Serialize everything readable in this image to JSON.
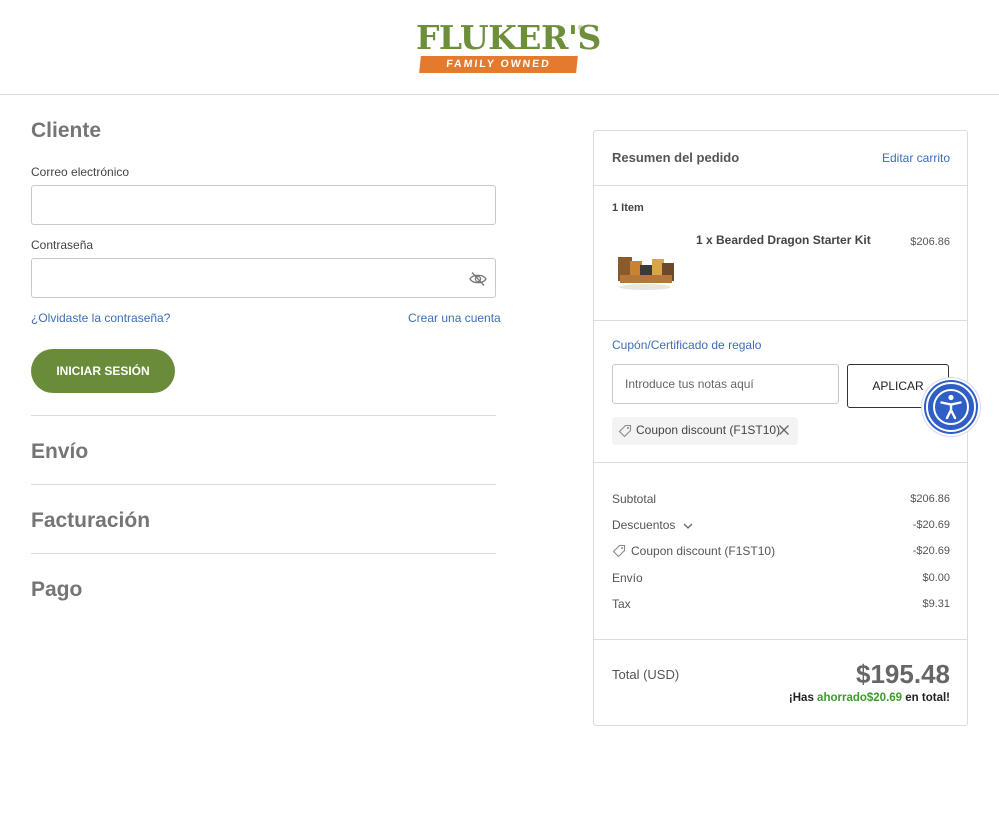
{
  "header": {
    "logo_word": "FLUKER'S",
    "logo_reg": "®",
    "logo_tagline": "FAMILY OWNED",
    "colors": {
      "green": "#6d8f3a",
      "orange": "#e47a2e"
    }
  },
  "customer": {
    "heading": "Cliente",
    "email_label": "Correo electrónico",
    "email_value": "",
    "password_label": "Contraseña",
    "password_value": "",
    "password_icon": "eye-off-icon",
    "forgot_link": "¿Olvidaste la contraseña?",
    "create_link": "Crear una cuenta",
    "login_button": "INICIAR SESIÓN"
  },
  "steps": {
    "shipping": "Envío",
    "billing": "Facturación",
    "payment": "Pago"
  },
  "summary": {
    "title": "Resumen del pedido",
    "edit_link": "Editar carrito",
    "item_count": "1 Item",
    "item": {
      "name": "1 x Bearded Dragon Starter Kit",
      "price": "$206.86",
      "thumbnail_icon": "product-image"
    },
    "coupon_link": "Cupón/Certificado de regalo",
    "coupon_placeholder": "Introduce tus notas aquí",
    "coupon_value": "",
    "apply_button": "APLICAR",
    "applied_coupon": "Coupon discount (F1ST10)",
    "rows": {
      "subtotal_label": "Subtotal",
      "subtotal_value": "$206.86",
      "discounts_label": "Descuentos",
      "discounts_value": "-$20.69",
      "coupon_label": "Coupon discount (F1ST10)",
      "coupon_value": "-$20.69",
      "shipping_label": "Envío",
      "shipping_value": "$0.00",
      "tax_label": "Tax",
      "tax_value": "$9.31"
    },
    "total_label": "Total (USD)",
    "total_value": "$195.48",
    "saved_prefix": "¡Has ",
    "saved_word": "ahorrado",
    "saved_amount": "$20.69",
    "saved_suffix": " en total!",
    "colors": {
      "link": "#3b6fb6",
      "saved": "#3f9a2c",
      "button": "#6a8c3a"
    }
  },
  "accessibility": {
    "icon": "accessibility-icon",
    "color": "#2f5ec4"
  }
}
